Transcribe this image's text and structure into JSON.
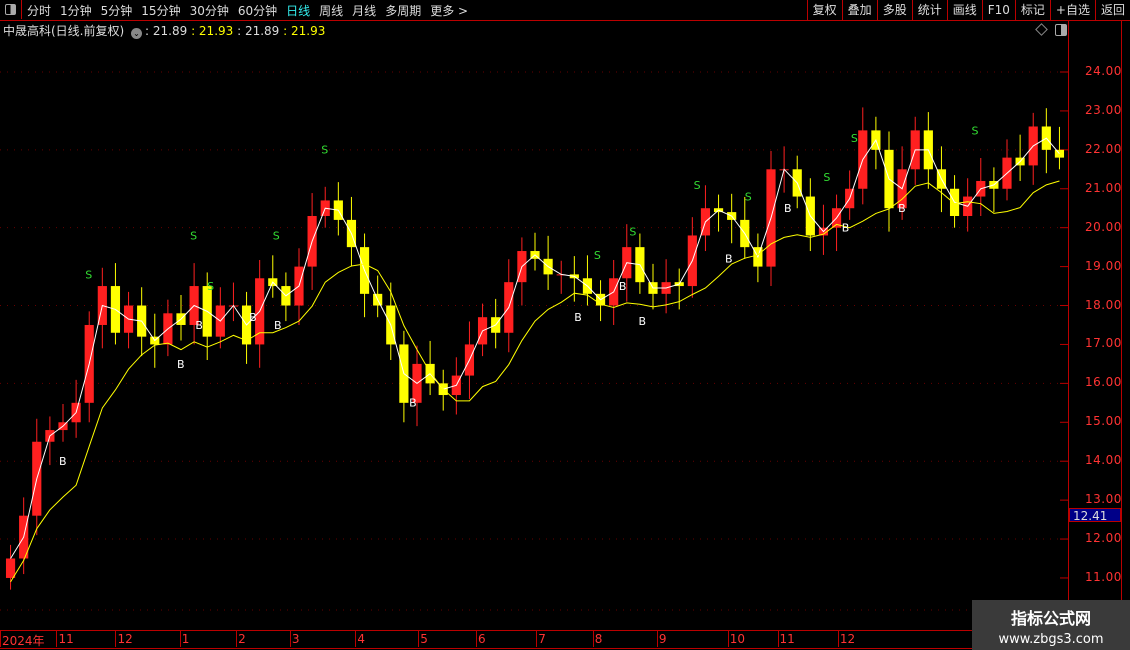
{
  "toolbar": {
    "periods": [
      "分时",
      "1分钟",
      "5分钟",
      "15分钟",
      "30分钟",
      "60分钟",
      "日线",
      "周线",
      "月线",
      "多周期",
      "更多 >"
    ],
    "active_period": "日线",
    "tools": [
      "复权",
      "叠加",
      "多股",
      "统计",
      "画线",
      "F10",
      "标记",
      "+自选",
      "返回"
    ]
  },
  "info": {
    "title": "中晟高科(日线.前复权)",
    "v1": ": 21.89",
    "v2": ": 21.93",
    "v3": ": 21.89",
    "v4": ": 21.93"
  },
  "colors": {
    "up": "#ff2020",
    "down": "#ffff00",
    "ma_short": "#ffffff",
    "ma_long": "#ffff00",
    "buy": "#ffffff",
    "sell": "#33dd33"
  },
  "chart_data": {
    "type": "candlestick",
    "y_ticks": [
      "24.00",
      "23.00",
      "22.00",
      "21.00",
      "20.00",
      "19.00",
      "18.00",
      "17.00",
      "16.00",
      "15.00",
      "14.00",
      "13.00",
      "12.00",
      "11.00"
    ],
    "ylim": [
      10.6,
      25.2
    ],
    "x_labels": [
      {
        "label": "2024年",
        "i": 0
      },
      {
        "label": "11",
        "i": 4
      },
      {
        "label": "12",
        "i": 8.5
      },
      {
        "label": "1",
        "i": 13.4
      },
      {
        "label": "2",
        "i": 17.7
      },
      {
        "label": "3",
        "i": 21.8
      },
      {
        "label": "4",
        "i": 26.8
      },
      {
        "label": "5",
        "i": 31.6
      },
      {
        "label": "6",
        "i": 36
      },
      {
        "label": "7",
        "i": 40.6
      },
      {
        "label": "8",
        "i": 44.9
      },
      {
        "label": "9",
        "i": 49.8
      },
      {
        "label": "10",
        "i": 55.2
      },
      {
        "label": "11",
        "i": 59
      },
      {
        "label": "12",
        "i": 63.6
      }
    ],
    "current_price": "12.41",
    "closes": [
      11.5,
      12.6,
      14.5,
      14.8,
      15,
      15.5,
      17.5,
      18.5,
      17.3,
      18,
      17.2,
      17,
      17.8,
      17.5,
      18.5,
      17.2,
      18,
      18,
      17,
      18.7,
      18.5,
      18,
      19,
      20.3,
      20.7,
      20.2,
      19.5,
      18.3,
      18,
      17,
      15.5,
      16.5,
      16,
      15.7,
      16.2,
      17,
      17.7,
      17.3,
      18.6,
      19.4,
      19.2,
      18.8,
      18.8,
      18.7,
      18.3,
      18,
      18.7,
      19.5,
      18.6,
      18.3,
      18.6,
      18.5,
      19.8,
      20.5,
      20.4,
      20.2,
      19.5,
      19,
      21.5,
      21.5,
      20.8,
      19.8,
      20,
      20.5,
      21,
      22.5,
      22,
      20.5,
      21.5,
      22.5,
      21.5,
      21,
      20.3,
      20.8,
      21.2,
      21,
      21.8,
      21.6,
      22.6,
      22,
      21.8
    ],
    "signals": [
      {
        "type": "B",
        "i": 4
      },
      {
        "type": "S",
        "i": 6
      },
      {
        "type": "B",
        "i": 13
      },
      {
        "type": "S",
        "i": 14
      },
      {
        "type": "B",
        "i": 14.4
      },
      {
        "type": "S",
        "i": 15.3
      },
      {
        "type": "B",
        "i": 18.5
      },
      {
        "type": "S",
        "i": 20.3
      },
      {
        "type": "B",
        "i": 20.4
      },
      {
        "type": "S",
        "i": 24
      },
      {
        "type": "B",
        "i": 30.7
      },
      {
        "type": "B",
        "i": 43.3
      },
      {
        "type": "S",
        "i": 44.8
      },
      {
        "type": "B",
        "i": 46.7
      },
      {
        "type": "S",
        "i": 47.5
      },
      {
        "type": "B",
        "i": 48.2
      },
      {
        "type": "S",
        "i": 52.4
      },
      {
        "type": "B",
        "i": 54.8
      },
      {
        "type": "S",
        "i": 56.3
      },
      {
        "type": "B",
        "i": 59.3
      },
      {
        "type": "S",
        "i": 62.3
      },
      {
        "type": "B",
        "i": 63.7
      },
      {
        "type": "S",
        "i": 64.4
      },
      {
        "type": "B",
        "i": 68
      },
      {
        "type": "S",
        "i": 73.6
      }
    ]
  }
}
